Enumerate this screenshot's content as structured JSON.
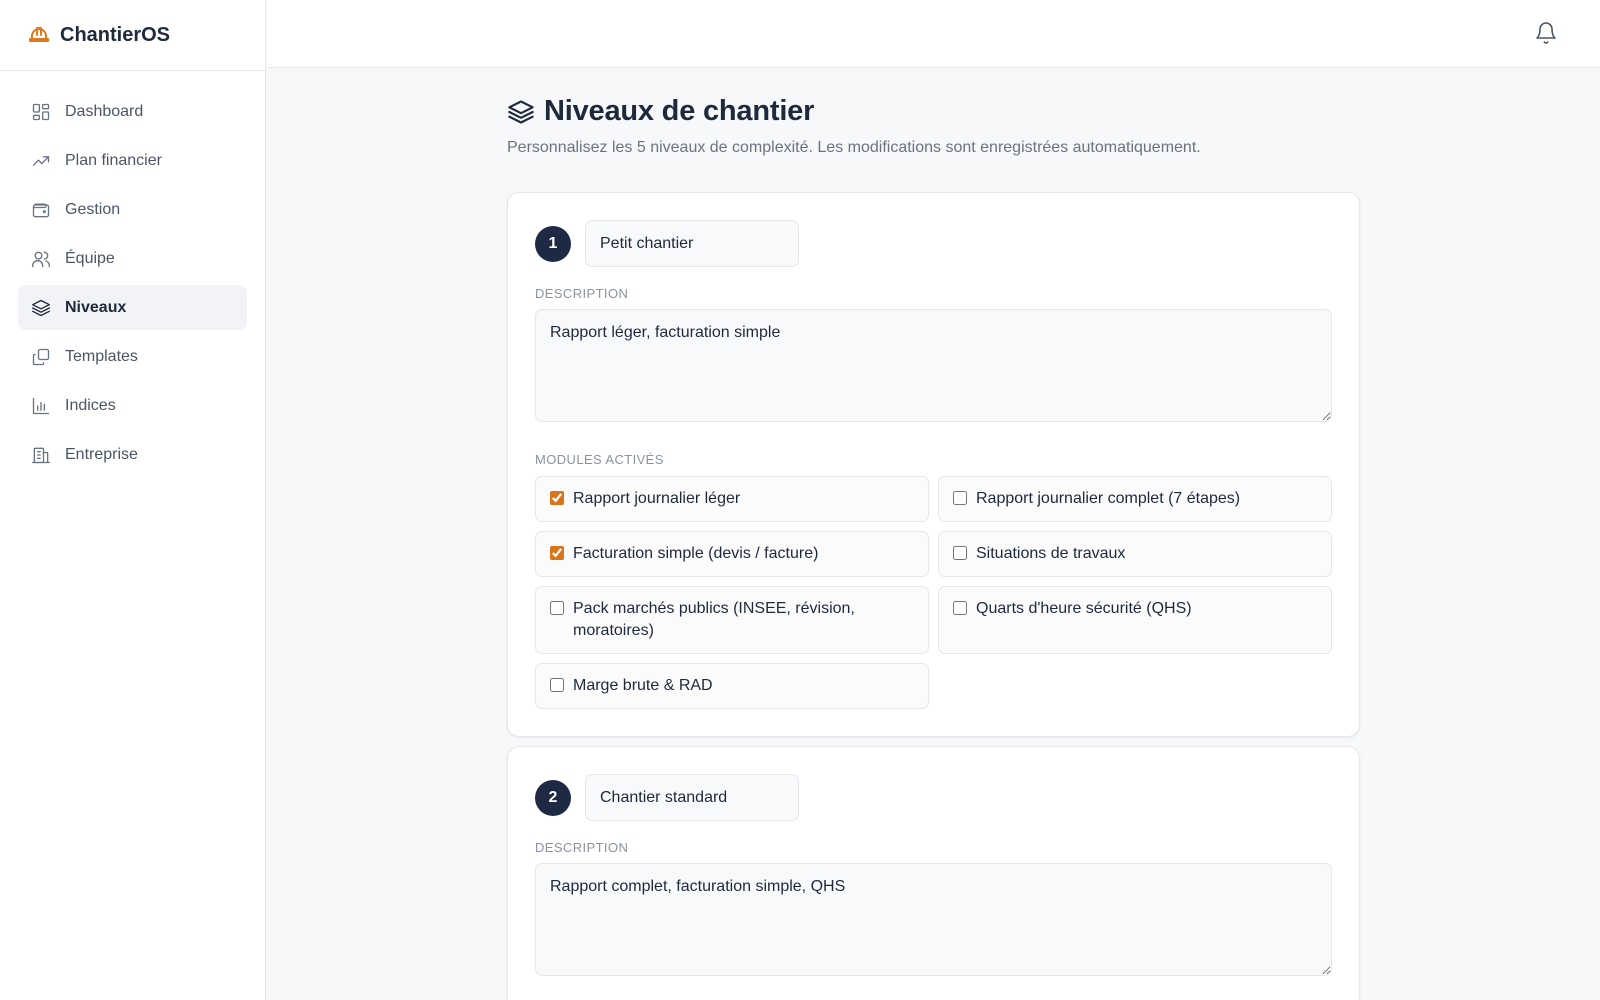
{
  "app": {
    "name": "ChantierOS",
    "accent": "#e07a1f"
  },
  "sidebar": {
    "items": [
      {
        "label": "Dashboard",
        "icon": "dashboard-icon",
        "active": false
      },
      {
        "label": "Plan financier",
        "icon": "trending-up-icon",
        "active": false
      },
      {
        "label": "Gestion",
        "icon": "wallet-icon",
        "active": false
      },
      {
        "label": "Équipe",
        "icon": "users-icon",
        "active": false
      },
      {
        "label": "Niveaux",
        "icon": "layers-icon",
        "active": true
      },
      {
        "label": "Templates",
        "icon": "copy-icon",
        "active": false
      },
      {
        "label": "Indices",
        "icon": "bar-chart-icon",
        "active": false
      },
      {
        "label": "Entreprise",
        "icon": "building-icon",
        "active": false
      }
    ]
  },
  "header": {
    "bell_icon": "bell-icon"
  },
  "page": {
    "title": "Niveaux de chantier",
    "subtitle": "Personnalisez les 5 niveaux de complexité. Les modifications sont enregistrées automatiquement."
  },
  "labels": {
    "description": "DESCRIPTION",
    "modules": "MODULES ACTIVÉS"
  },
  "levels": [
    {
      "number": "1",
      "name": "Petit chantier",
      "description": "Rapport léger, facturation simple",
      "modules": [
        {
          "label": "Rapport journalier léger",
          "checked": true
        },
        {
          "label": "Rapport journalier complet (7 étapes)",
          "checked": false
        },
        {
          "label": "Facturation simple (devis / facture)",
          "checked": true
        },
        {
          "label": "Situations de travaux",
          "checked": false
        },
        {
          "label": "Pack marchés publics (INSEE, révision, moratoires)",
          "checked": false
        },
        {
          "label": "Quarts d'heure sécurité (QHS)",
          "checked": false
        },
        {
          "label": "Marge brute & RAD",
          "checked": false
        }
      ]
    },
    {
      "number": "2",
      "name": "Chantier standard",
      "description": "Rapport complet, facturation simple, QHS"
    }
  ]
}
